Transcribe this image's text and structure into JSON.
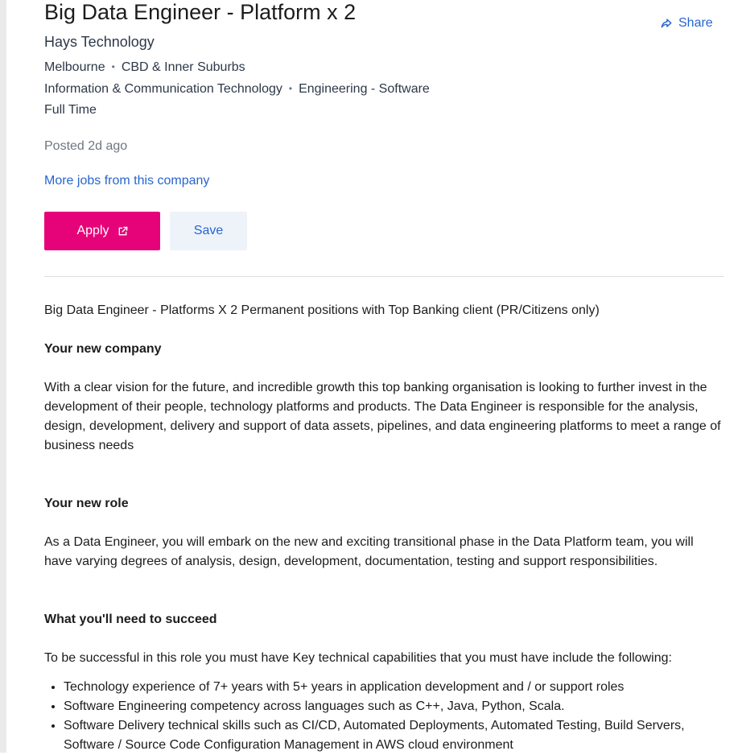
{
  "job": {
    "title": "Big Data Engineer - Platform x 2",
    "company": "Hays Technology",
    "location": "Melbourne",
    "area": "CBD & Inner Suburbs",
    "classification": "Information & Communication Technology",
    "subclassification": "Engineering - Software",
    "work_type": "Full Time",
    "posted": "Posted 2d ago",
    "more_jobs_link": "More jobs from this company"
  },
  "actions": {
    "share_label": "Share",
    "share_icon": "share-arrow-icon",
    "apply_label": "Apply",
    "apply_icon": "external-link-icon",
    "save_label": "Save"
  },
  "description": {
    "intro": "Big Data Engineer - Platforms X 2 Permanent positions with Top Banking client (PR/Citizens only)",
    "company_heading": "Your new company",
    "company_text": "With a clear vision for the future, and incredible growth this top banking organisation is looking to further invest in the development of their people, technology platforms and products. The Data Engineer is responsible for the analysis, design, development, delivery and support of data assets, pipelines, and data engineering platforms to meet a range of business needs",
    "role_heading": "Your new role",
    "role_text": "As a Data Engineer, you will embark on the new and exciting transitional phase in the Data Platform team, you will have varying degrees of analysis, design, development, documentation, testing and support responsibilities.",
    "succeed_heading": "What you'll need to succeed",
    "succeed_text": "To be successful in this role you must have Key technical capabilities that you must have include the following:",
    "requirements": [
      "Technology experience of 7+ years with 5+ years in application development and / or support roles",
      "Software Engineering competency across languages such as C++, Java, Python, Scala.",
      "Software Delivery technical skills such as CI/CD, Automated Deployments, Automated Testing, Build Servers, Software / Source Code Configuration Management in AWS cloud environment"
    ]
  },
  "colors": {
    "apply_bg": "#e60278",
    "save_bg": "#eef3fa",
    "link": "#2765cf",
    "text": "#1c1c1c",
    "muted": "#6e7681"
  }
}
